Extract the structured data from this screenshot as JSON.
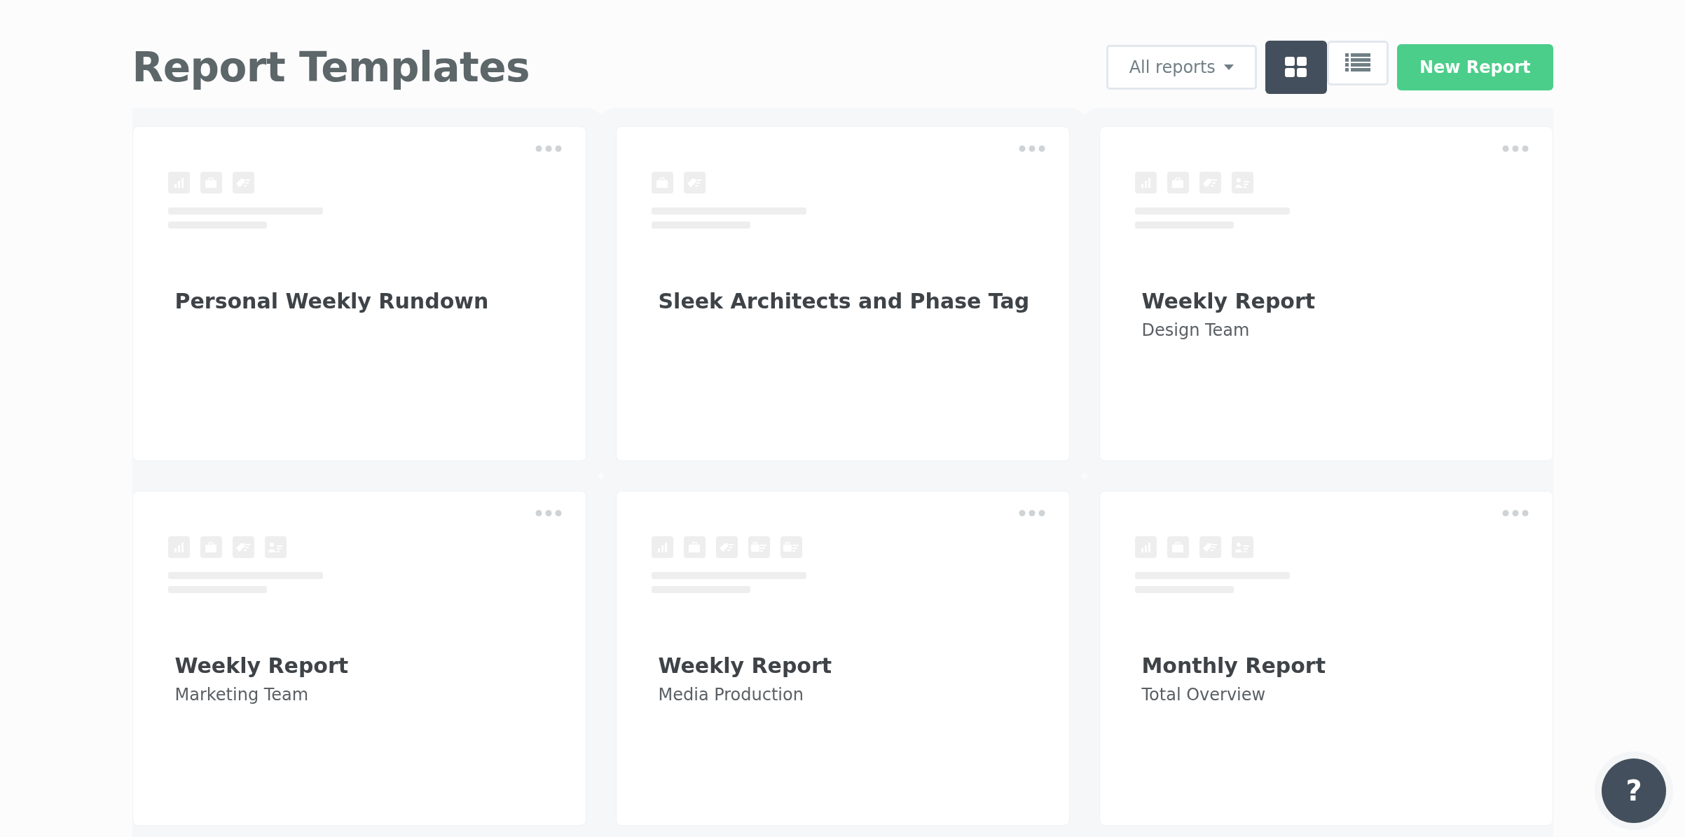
{
  "header": {
    "title": "Report Templates",
    "filter": {
      "label": "All reports"
    },
    "views": [
      {
        "kind": "grid",
        "selected": true
      },
      {
        "kind": "list",
        "selected": false
      }
    ],
    "new_button": "New Report"
  },
  "cards": [
    {
      "title": "Personal Weekly Rundown",
      "icons": [
        {
          "kind": "chart"
        },
        {
          "kind": "briefcase"
        },
        {
          "kind": "tag"
        }
      ]
    },
    {
      "title": "Sleek Architects and Phase Tag",
      "icons": [
        {
          "kind": "briefcase"
        },
        {
          "kind": "tag"
        }
      ]
    },
    {
      "title": "Weekly Report",
      "subtitle": "Design Team",
      "icons": [
        {
          "kind": "chart"
        },
        {
          "kind": "briefcase"
        },
        {
          "kind": "tag"
        },
        {
          "kind": "person"
        }
      ]
    },
    {
      "title": "Weekly Report",
      "subtitle": "Marketing Team",
      "icons": [
        {
          "kind": "chart"
        },
        {
          "kind": "briefcase"
        },
        {
          "kind": "tag"
        },
        {
          "kind": "person"
        }
      ]
    },
    {
      "title": "Weekly Report",
      "subtitle": "Media Production",
      "icons": [
        {
          "kind": "chart"
        },
        {
          "kind": "briefcase"
        },
        {
          "kind": "tag"
        },
        {
          "kind": "briefcase-list"
        },
        {
          "kind": "briefcase-list"
        }
      ]
    },
    {
      "title": "Monthly Report",
      "subtitle": "Total Overview",
      "icons": [
        {
          "kind": "chart"
        },
        {
          "kind": "briefcase"
        },
        {
          "kind": "tag"
        },
        {
          "kind": "person"
        }
      ]
    }
  ],
  "help": {
    "label": "?"
  }
}
